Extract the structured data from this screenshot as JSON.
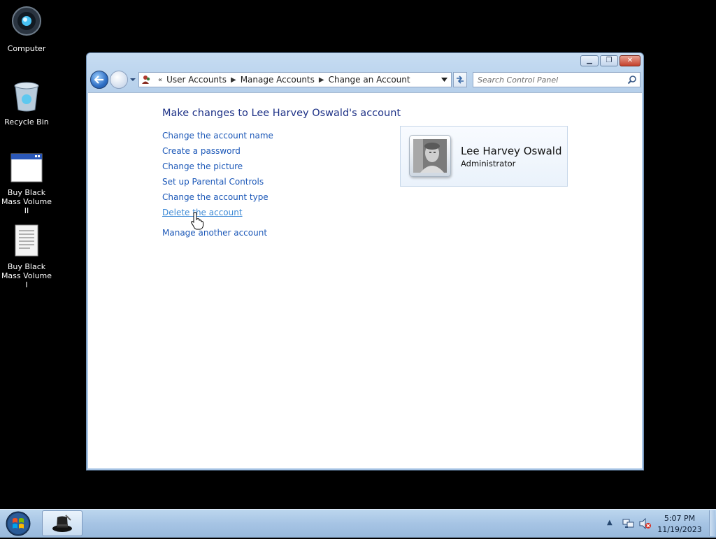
{
  "desktop": {
    "icons": [
      {
        "label": "Computer"
      },
      {
        "label": "Recycle Bin"
      },
      {
        "label": "Buy Black Mass Volume II"
      },
      {
        "label": "Buy Black Mass Volume I"
      }
    ]
  },
  "window": {
    "address": {
      "crumbs": [
        "User Accounts",
        "Manage Accounts",
        "Change an Account"
      ]
    },
    "search": {
      "placeholder": "Search Control Panel"
    },
    "page_title": "Make changes to Lee Harvey Oswald's account",
    "tasks": [
      "Change the account name",
      "Create a password",
      "Change the picture",
      "Set up Parental Controls",
      "Change the account type",
      "Delete the account"
    ],
    "manage_another": "Manage another account",
    "account": {
      "name": "Lee Harvey Oswald",
      "role": "Administrator"
    }
  },
  "taskbar": {
    "clock": {
      "time": "5:07 PM",
      "date": "11/19/2023"
    }
  },
  "colors": {
    "link": "#1c58b8",
    "link_hover": "#3e8ad6",
    "title": "#1e3287",
    "desktop": "#000000"
  }
}
